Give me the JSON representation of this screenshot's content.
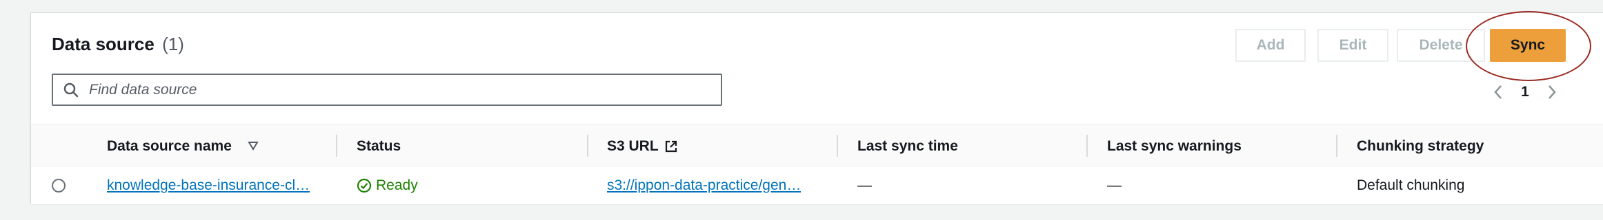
{
  "section": {
    "title": "Data source",
    "count": "(1)"
  },
  "actions": {
    "add": "Add",
    "edit": "Edit",
    "delete": "Delete",
    "sync": "Sync"
  },
  "search": {
    "placeholder": "Find data source"
  },
  "pagination": {
    "current_page": "1"
  },
  "table": {
    "columns": [
      {
        "label": "Data source name",
        "icon": "sort-down-icon"
      },
      {
        "label": "Status"
      },
      {
        "label": "S3 URL",
        "icon": "external-link-icon"
      },
      {
        "label": "Last sync time"
      },
      {
        "label": "Last sync warnings"
      },
      {
        "label": "Chunking strategy"
      }
    ],
    "rows": [
      {
        "name": "knowledge-base-insurance-cl…",
        "status": "Ready",
        "s3_url": "s3://ippon-data-practice/gen…",
        "last_sync_time": "—",
        "last_sync_warnings": "—",
        "chunking_strategy": "Default chunking"
      }
    ]
  },
  "colors": {
    "primary_button": "#ec9f3a",
    "link": "#0073bb",
    "success": "#1d8102",
    "highlight_ring": "#9a2a22"
  }
}
